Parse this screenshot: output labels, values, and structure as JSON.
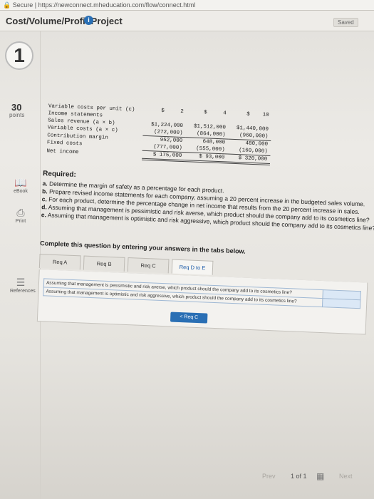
{
  "browser": {
    "url": "Secure | https://newconnect.mheducation.com/flow/connect.html"
  },
  "header": {
    "title": "Cost/Volume/Profit Project",
    "saved_label": "Saved"
  },
  "question": {
    "number": "1",
    "points": "30",
    "points_label": "points"
  },
  "sidebar": {
    "tools": [
      {
        "label": "eBook",
        "icon": "book-icon"
      },
      {
        "label": "Print",
        "icon": "printer-icon"
      },
      {
        "label": "References",
        "icon": "references-icon"
      }
    ]
  },
  "statement": {
    "header_row": {
      "label": "Variable costs per unit (c)",
      "c1_prefix": "$",
      "c1": "2",
      "c2_prefix": "$",
      "c2": "4",
      "c3_prefix": "$",
      "c3": "10"
    },
    "rows": [
      {
        "label": "Income statements",
        "c1": "",
        "c2": "",
        "c3": ""
      },
      {
        "label": "Sales revenue (a × b)",
        "c1": "$1,224,000",
        "c2": "$1,512,000",
        "c3": "$1,440,000"
      },
      {
        "label": "Variable costs (a × c)",
        "c1": "(272,000)",
        "c2": "(864,000)",
        "c3": "(960,000)"
      },
      {
        "label": "Contribution margin",
        "c1": "952,000",
        "c2": "648,000",
        "c3": "480,000"
      },
      {
        "label": "Fixed costs",
        "c1": "(777,000)",
        "c2": "(555,000)",
        "c3": "(160,000)"
      },
      {
        "label": "Net income",
        "c1": "$ 175,000",
        "c2": "$ 93,000",
        "c3": "$ 320,000"
      }
    ]
  },
  "required": {
    "title": "Required:",
    "items": [
      {
        "key": "a.",
        "text": "Determine the margin of safety as a percentage for each product."
      },
      {
        "key": "b.",
        "text": "Prepare revised income statements for each company, assuming a 20 percent increase in the budgeted sales volume."
      },
      {
        "key": "c.",
        "text": "For each product, determine the percentage change in net income that results from the 20 percent increase in sales."
      },
      {
        "key": "d.",
        "text": "Assuming that management is pessimistic and risk averse, which product should the company add to its cosmetics line?"
      },
      {
        "key": "e.",
        "text": "Assuming that management is optimistic and risk aggressive, which product should the company add to its cosmetics line?"
      }
    ]
  },
  "instructions": "Complete this question by entering your answers in the tabs below.",
  "tabs": [
    {
      "label": "Req A"
    },
    {
      "label": "Req B"
    },
    {
      "label": "Req C"
    },
    {
      "label": "Req D to E"
    }
  ],
  "panel": {
    "rows": [
      {
        "question": "Assuming that management is pessimistic and risk averse, which product should the company add to its cosmetics line?",
        "answer": ""
      },
      {
        "question": "Assuming that management is optimistic and risk aggressive, which product should the company add to its cosmetics line?",
        "answer": ""
      }
    ],
    "back_button": "< Req C"
  },
  "footer": {
    "prev": "Prev",
    "page": "1 of 1",
    "next": "Next"
  }
}
